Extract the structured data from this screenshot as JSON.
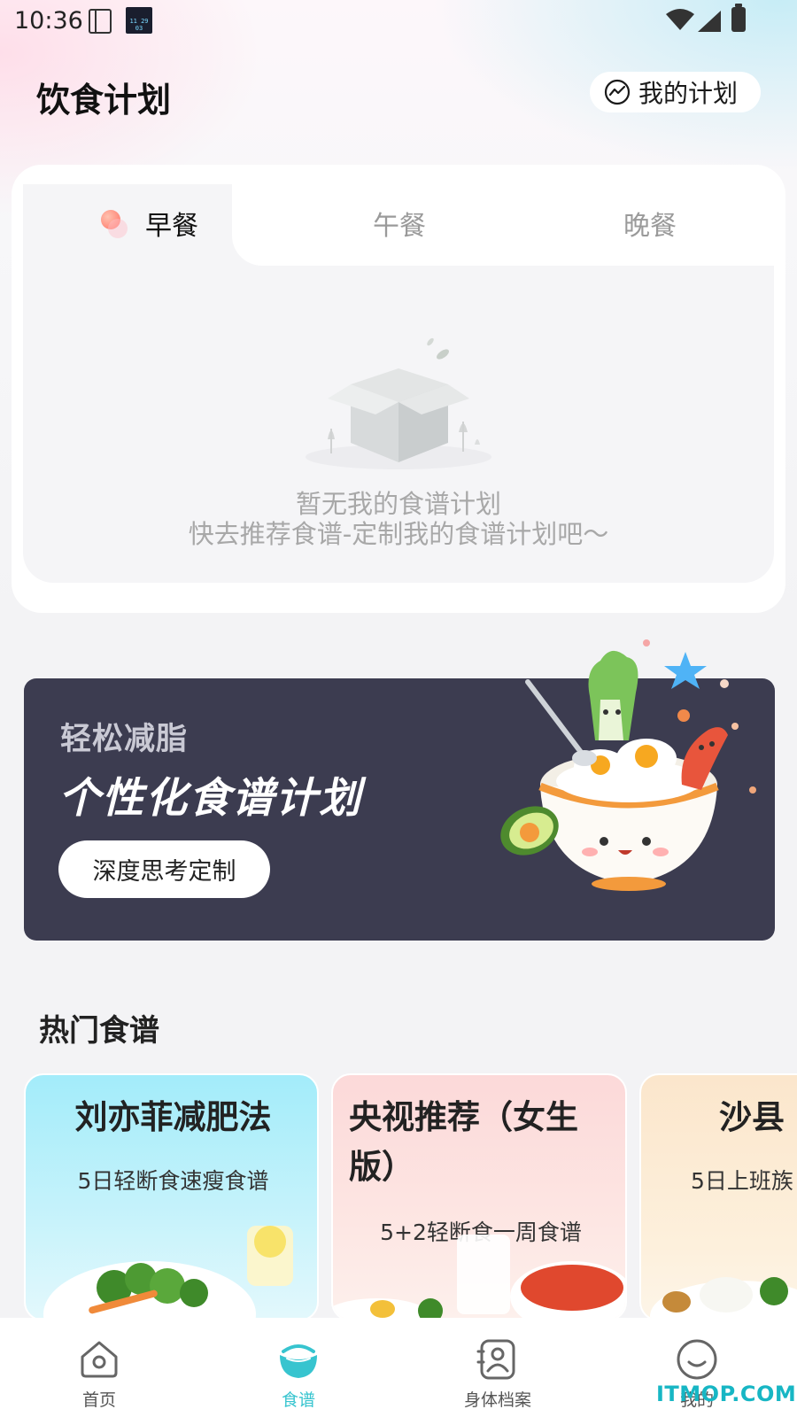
{
  "status_bar": {
    "time": "10:36",
    "clock_widget": [
      "11",
      "29",
      "03"
    ]
  },
  "header": {
    "title": "饮食计划",
    "my_plan_label": "我的计划"
  },
  "meal_tabs": [
    {
      "label": "早餐",
      "selected": true
    },
    {
      "label": "午餐",
      "selected": false
    },
    {
      "label": "晚餐",
      "selected": false
    }
  ],
  "empty_state": {
    "title": "暂无我的食谱计划",
    "subtitle": "快去推荐食谱-定制我的食谱计划吧～"
  },
  "banner": {
    "subtitle": "轻松减脂",
    "title": "个性化食谱计划",
    "button_label": "深度思考定制"
  },
  "hot_recipes": {
    "section_title": "热门食谱",
    "cards": [
      {
        "title": "刘亦菲减肥法",
        "subtitle": "5日轻断食速瘦食谱"
      },
      {
        "title": "央视推荐（女生版）",
        "subtitle": "5+2轻断食一周食谱"
      },
      {
        "title": "沙县",
        "subtitle": "5日上班族"
      }
    ]
  },
  "bottom_nav": [
    {
      "label": "首页",
      "icon": "home-icon",
      "active": false
    },
    {
      "label": "食谱",
      "icon": "bowl-icon",
      "active": true
    },
    {
      "label": "身体档案",
      "icon": "body-profile-icon",
      "active": false
    },
    {
      "label": "我的",
      "icon": "smile-icon",
      "active": false
    }
  ],
  "watermark": "ITMOP.COM",
  "colors": {
    "accent": "#37c4cf",
    "banner_bg": "#3c3c50",
    "page_bg": "#f3f3f5"
  }
}
